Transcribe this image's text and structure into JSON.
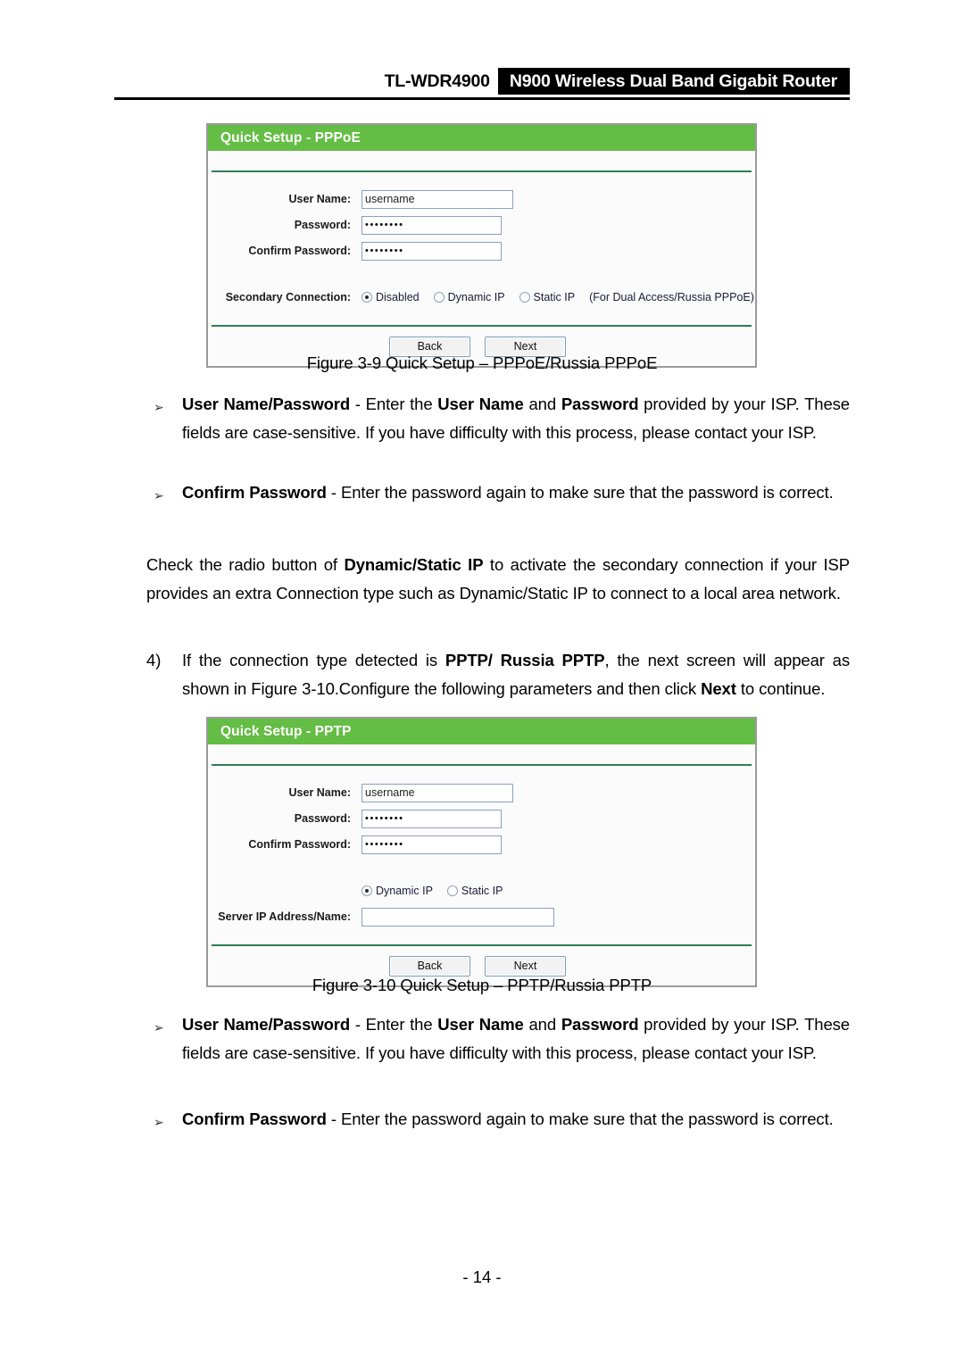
{
  "header": {
    "model": "TL-WDR4900",
    "product": "N900 Wireless Dual Band Gigabit Router"
  },
  "panel_pppoe": {
    "title": "Quick Setup - PPPoE",
    "fields": {
      "user_name_label": "User Name:",
      "user_name_value": "username",
      "password_label": "Password:",
      "password_value": "••••••••",
      "confirm_password_label": "Confirm Password:",
      "confirm_password_value": "••••••••"
    },
    "secondary": {
      "label": "Secondary Connection:",
      "options": [
        {
          "label": "Disabled",
          "checked": true
        },
        {
          "label": "Dynamic IP",
          "checked": false
        },
        {
          "label": "Static IP",
          "checked": false
        }
      ],
      "note": "(For Dual Access/Russia PPPoE)"
    },
    "buttons": {
      "back": "Back",
      "next": "Next"
    }
  },
  "panel_pptp": {
    "title": "Quick Setup - PPTP",
    "fields": {
      "user_name_label": "User Name:",
      "user_name_value": "username",
      "password_label": "Password:",
      "password_value": "••••••••",
      "confirm_password_label": "Confirm Password:",
      "confirm_password_value": "••••••••",
      "server_label": "Server IP Address/Name:",
      "server_value": ""
    },
    "ip_mode": {
      "options": [
        {
          "label": "Dynamic IP",
          "checked": true
        },
        {
          "label": "Static IP",
          "checked": false
        }
      ]
    },
    "buttons": {
      "back": "Back",
      "next": "Next"
    }
  },
  "captions": {
    "fig_3_9": "Figure 3-9 Quick Setup – PPPoE/Russia PPPoE",
    "fig_3_10": "Figure 3-10 Quick Setup – PPTP/Russia PPTP"
  },
  "body": {
    "bullet_marker": "➢",
    "user_pass_1": {
      "term": "User Name/Password",
      "dash": " - ",
      "t1": "Enter the ",
      "b1": "User Name",
      "t2": " and ",
      "b2": "Password",
      "t3": " provided by your ISP. These fields are case-sensitive. If you have difficulty with this process, please contact your ISP."
    },
    "confirm_1": {
      "term": "Confirm Password",
      "dash": " - ",
      "t1": "Enter the password again to make sure that the password is correct."
    },
    "check_radio": {
      "t1": "Check the radio button of ",
      "b1": "Dynamic/Static IP",
      "t2": " to activate the secondary connection if your ISP provides an extra Connection type such as Dynamic/Static IP to connect to a local area network."
    },
    "step4": {
      "number": "4)",
      "t1": "If the connection type detected is ",
      "b1": "PPTP/ Russia PPTP",
      "t2": ", the next screen will appear as shown in Figure 3-10.Configure the following parameters and then click ",
      "b2": "Next",
      "t3": " to continue."
    },
    "user_pass_2": {
      "term": "User Name/Password",
      "dash": " - ",
      "t1": "Enter the ",
      "b1": "User Name",
      "t2": " and ",
      "b2": "Password",
      "t3": " provided by your ISP. These fields are case-sensitive. If you have difficulty with this process, please contact your ISP."
    },
    "confirm_2": {
      "term": "Confirm Password",
      "dash": " - ",
      "t1": "Enter the password again to make sure that the password is correct."
    }
  },
  "footer": {
    "page_number": "- 14 -"
  },
  "colors": {
    "panel_header_green": "#64bd44",
    "separator_green": "#2e7d55",
    "panel_border_gray": "#9a9a9a",
    "input_border_blue": "#8aa1bf"
  }
}
